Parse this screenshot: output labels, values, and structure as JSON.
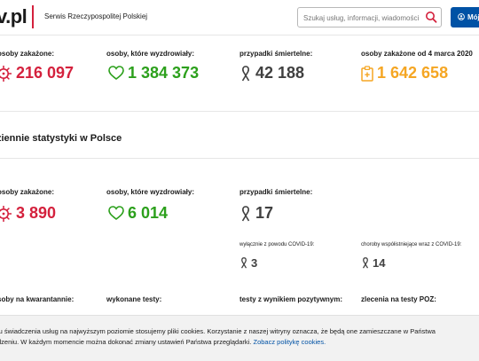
{
  "header": {
    "logo": "v.pl",
    "serwis": "Serwis Rzeczypospolitej Polskiej",
    "search_placeholder": "Szukaj usług, informacji, wiadomości",
    "account_label": "Mój"
  },
  "totals": {
    "infected_label": "osoby zakażone:",
    "infected_value": "216 097",
    "recovered_label": "osoby, które wyzdrowiały:",
    "recovered_value": "1 384 373",
    "deaths_label": "przypadki śmiertelne:",
    "deaths_value": "42 188",
    "since_label": "osoby zakażone od 4 marca 2020",
    "since_value": "1 642 658"
  },
  "daily": {
    "section_title": "ziennie statystyki w Polsce",
    "infected_label": "osoby zakażone:",
    "infected_value": "3 890",
    "recovered_label": "osoby, które wyzdrowiały:",
    "recovered_value": "6 014",
    "deaths_label": "przypadki śmiertelne:",
    "deaths_value": "17",
    "covid_only_label": "wyłącznie z powodu COVID-19:",
    "covid_only_value": "3",
    "comorbid_label": "choroby współistniejące wraz z COVID-19:",
    "comorbid_value": "14",
    "quarantine_label": "soby na kwarantannie:",
    "tests_label": "wykonane testy:",
    "positive_label": "testy z wynikiem pozytywnym:",
    "orders_label": "zlecenia na testy POZ:"
  },
  "cookie": {
    "text_line1": "lu świadczenia usług na najwyższym poziomie stosujemy pliki cookies. Korzystanie z naszej witryny oznacza, że będą one zamieszczane w Państwa",
    "text_line2": "dzeniu. W każdym momencie można dokonać zmiany ustawień Państwa przeglądarki.",
    "link": "Zobacz politykę cookies."
  },
  "colors": {
    "red": "#d4213d",
    "green": "#2ca01c",
    "grey": "#404040",
    "orange": "#f5a623",
    "blue": "#0052a5"
  }
}
